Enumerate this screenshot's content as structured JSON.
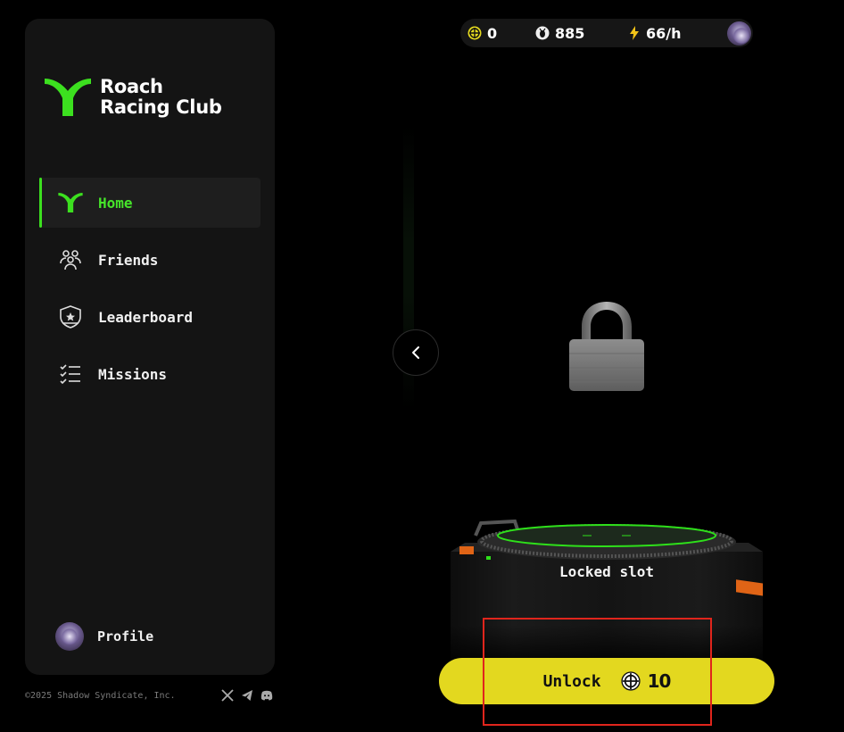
{
  "brand": {
    "line1": "Roach",
    "line2": "Racing Club",
    "accent": "#3ce01f"
  },
  "sidebar": {
    "items": [
      {
        "label": "Home",
        "icon": "roach-logo-icon",
        "active": true
      },
      {
        "label": "Friends",
        "icon": "friends-icon"
      },
      {
        "label": "Leaderboard",
        "icon": "leaderboard-icon"
      },
      {
        "label": "Missions",
        "icon": "missions-icon"
      }
    ],
    "profile": {
      "label": "Profile"
    }
  },
  "footer": {
    "copyright": "©2025 Shadow Syndicate, Inc.",
    "socials": [
      "x-icon",
      "telegram-icon",
      "discord-icon"
    ]
  },
  "stats": {
    "token": "0",
    "roach": "885",
    "rate": "66/h"
  },
  "slot": {
    "status": "Locked slot",
    "unlock_label": "Unlock",
    "unlock_cost": "10",
    "button_color": "#e3d81f"
  }
}
